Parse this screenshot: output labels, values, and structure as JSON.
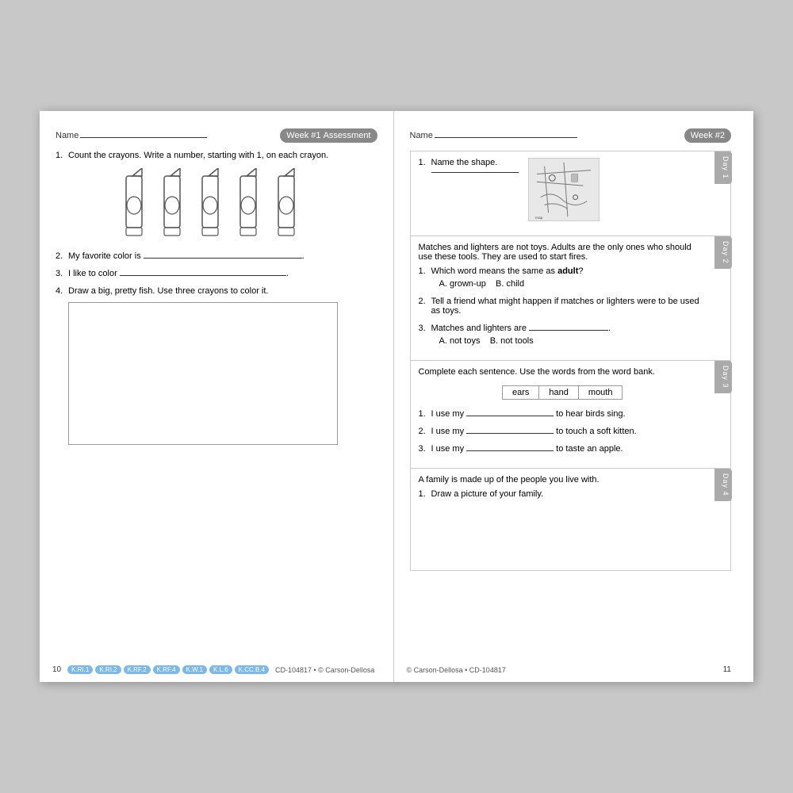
{
  "left_page": {
    "name_label": "Name",
    "week_badge": "Week #1",
    "week_badge_sub": "Assessment",
    "page_number": "10",
    "standards": [
      "K.RI.1",
      "K.RI.2",
      "K.RF.2",
      "K.RF.4",
      "K.W.1",
      "K.L.6",
      "K.CC.B.4"
    ],
    "copyright": "CD-104817 • © Carson-Dellosa",
    "questions": [
      {
        "num": "1.",
        "text": "Count the crayons. Write a number, starting with 1, on each crayon."
      },
      {
        "num": "2.",
        "text": "My favorite color is"
      },
      {
        "num": "3.",
        "text": "I like to color"
      },
      {
        "num": "4.",
        "text": "Draw a big, pretty fish. Use three crayons to color it."
      }
    ]
  },
  "right_page": {
    "name_label": "Name",
    "week_badge": "Week #2",
    "page_number": "11",
    "copyright_left": "© Carson-Dellosa • CD-104817",
    "days": [
      {
        "label": "Day 1",
        "sections": [
          {
            "questions": [
              {
                "num": "1.",
                "text": "Name the shape.",
                "has_map": true,
                "answer_line": true
              }
            ]
          }
        ]
      },
      {
        "label": "Day 2",
        "intro": "Matches and lighters are not toys. Adults are the only ones who should use these tools. They are used to start fires.",
        "sections": [
          {
            "questions": [
              {
                "num": "1.",
                "text": "Which word means the same as",
                "bold_word": "adult",
                "text_after": "?",
                "options": [
                  "A. grown-up",
                  "B. child"
                ]
              },
              {
                "num": "2.",
                "text": "Tell a friend what might happen if matches or lighters were to be used as toys."
              },
              {
                "num": "3.",
                "text": "Matches and lighters are",
                "answer_line": true,
                "text_after": ".",
                "options": [
                  "A. not toys",
                  "B. not tools"
                ]
              }
            ]
          }
        ]
      },
      {
        "label": "Day 3",
        "intro": "Complete each sentence. Use the words from the word bank.",
        "word_bank": [
          "ears",
          "hand",
          "mouth"
        ],
        "sections": [
          {
            "questions": [
              {
                "num": "1.",
                "text": "I use my",
                "answer_line": true,
                "text_after": "to hear birds sing."
              },
              {
                "num": "2.",
                "text": "I use my",
                "answer_line": true,
                "text_after": "to touch a soft kitten."
              },
              {
                "num": "3.",
                "text": "I use my",
                "answer_line": true,
                "text_after": "to taste an apple."
              }
            ]
          }
        ]
      },
      {
        "label": "Day 4",
        "intro": "A family is made up of the people you live with.",
        "sections": [
          {
            "questions": [
              {
                "num": "1.",
                "text": "Draw a picture of your family."
              }
            ]
          }
        ]
      }
    ]
  }
}
